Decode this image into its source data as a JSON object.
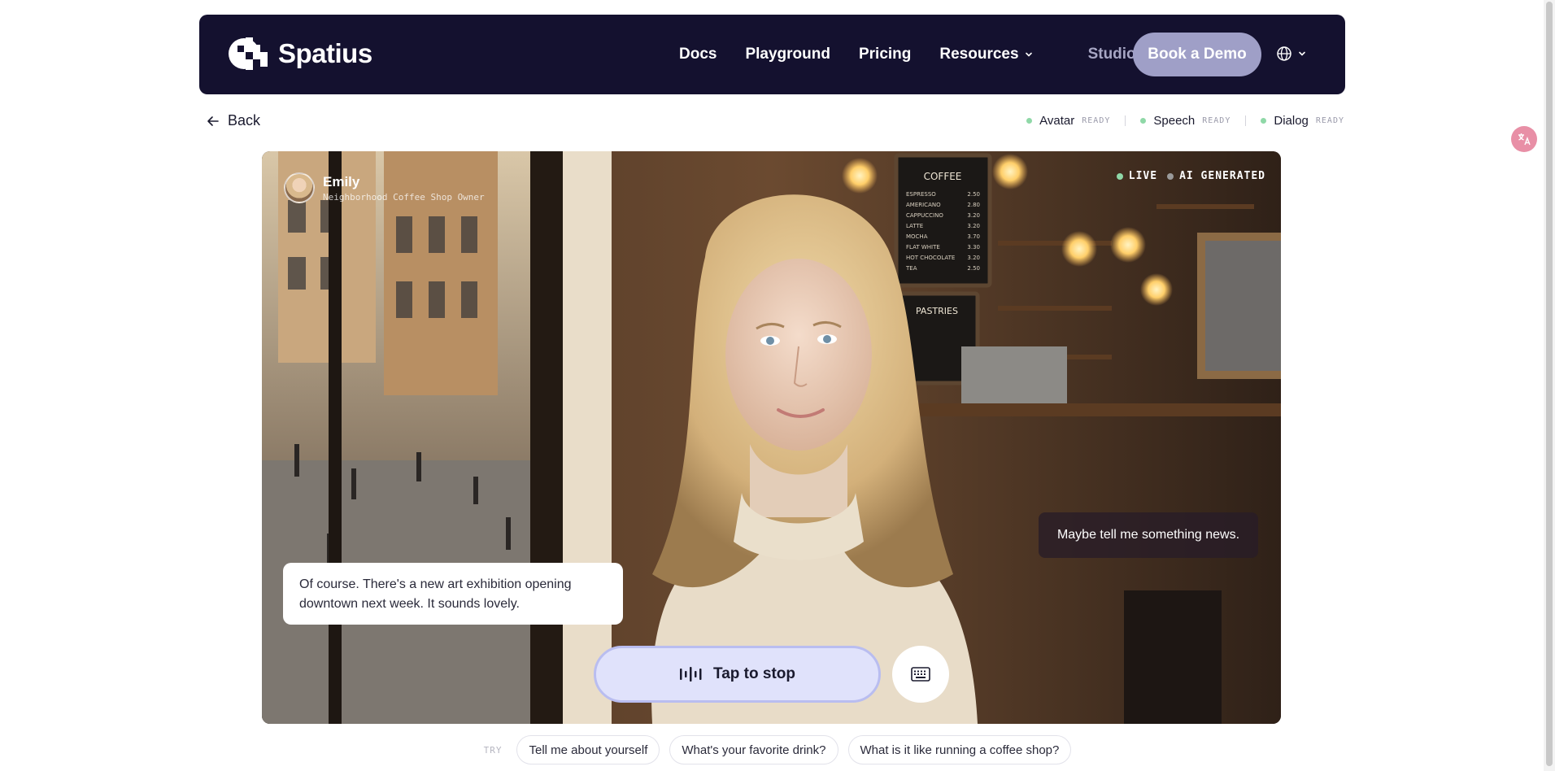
{
  "brand": {
    "name": "Spatius"
  },
  "nav": {
    "links": [
      "Docs",
      "Playground",
      "Pricing",
      "Resources"
    ],
    "studio": "Studio",
    "cta": "Book a Demo"
  },
  "back_label": "Back",
  "status": [
    {
      "name": "Avatar",
      "state": "READY"
    },
    {
      "name": "Speech",
      "state": "READY"
    },
    {
      "name": "Dialog",
      "state": "READY"
    }
  ],
  "persona": {
    "name": "Emily",
    "role": "Neighborhood Coffee Shop Owner"
  },
  "tags": {
    "live": "LIVE",
    "ai": "AI GENERATED"
  },
  "scene": {
    "menu_title": "COFFEE",
    "menu_items": [
      "ESPRESSO",
      "AMERICANO",
      "CAPPUCCINO",
      "LATTE",
      "MOCHA",
      "FLAT WHITE",
      "HOT CHOCOLATE",
      "TEA"
    ],
    "menu_prices": [
      "2.50",
      "2.80",
      "3.20",
      "3.20",
      "3.70",
      "3.30",
      "3.20",
      "2.50"
    ],
    "pastry_title": "PASTRIES"
  },
  "conversation": {
    "user": "Maybe tell me something news.",
    "assistant": "Of course. There's a new art exhibition opening downtown next week. It sounds lovely."
  },
  "controls": {
    "stop_label": "Tap to stop"
  },
  "suggestions": {
    "label": "TRY",
    "chips": [
      "Tell me about yourself",
      "What's your favorite drink?",
      "What is it like running a coffee shop?"
    ]
  },
  "colors": {
    "nav_bg": "#14112f",
    "cta_bg": "#9f9fc7",
    "ready_dot": "#8fd8a7",
    "stop_bg": "#e0e2fb"
  }
}
